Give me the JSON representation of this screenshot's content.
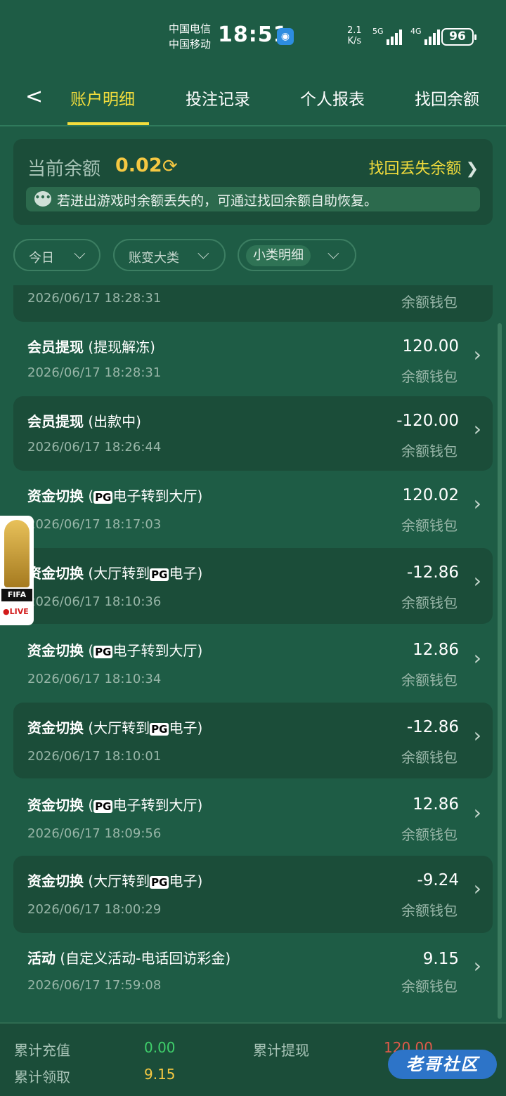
{
  "status_bar": {
    "carrier_1": "中国电信",
    "carrier_2": "中国移动",
    "time": "18:51",
    "net_speed_value": "2.1",
    "net_speed_unit": "K/s",
    "signal_1": "5G",
    "signal_2": "4G",
    "battery": "96"
  },
  "tabs": [
    "账户明细",
    "投注记录",
    "个人报表",
    "找回余额"
  ],
  "balance": {
    "label": "当前余额",
    "value": "0.02",
    "recover_label": "找回丢失余额",
    "notice": "若进出游戏时余额丢失的，可通过找回余额自助恢复。"
  },
  "filters": {
    "day": "今日",
    "category": "账变大类",
    "subcategory": "小类明细"
  },
  "transactions": [
    {
      "title": "",
      "detail": "",
      "time": "2026/06/17 18:28:31",
      "amount": "",
      "wallet": "余额钱包"
    },
    {
      "title": "会员提现",
      "detail": " (提现解冻)",
      "time": "2026/06/17 18:28:31",
      "amount": "120.00",
      "wallet": "余额钱包"
    },
    {
      "title": "会员提现",
      "detail": " (出款中)",
      "time": "2026/06/17 18:26:44",
      "amount": "-120.00",
      "wallet": "余额钱包"
    },
    {
      "title": "资金切换",
      "detail_pre": " (",
      "pg": "PG",
      "detail_post": "电子转到大厅)",
      "time": "2026/06/17 18:17:03",
      "amount": "120.02",
      "wallet": "余额钱包"
    },
    {
      "title": "资金切换",
      "detail_pre": " (大厅转到",
      "pg": "PG",
      "detail_post": "电子)",
      "time": "2026/06/17 18:10:36",
      "amount": "-12.86",
      "wallet": "余额钱包"
    },
    {
      "title": "资金切换",
      "detail_pre": " (",
      "pg": "PG",
      "detail_post": "电子转到大厅)",
      "time": "2026/06/17 18:10:34",
      "amount": "12.86",
      "wallet": "余额钱包"
    },
    {
      "title": "资金切换",
      "detail_pre": " (大厅转到",
      "pg": "PG",
      "detail_post": "电子)",
      "time": "2026/06/17 18:10:01",
      "amount": "-12.86",
      "wallet": "余额钱包"
    },
    {
      "title": "资金切换",
      "detail_pre": " (",
      "pg": "PG",
      "detail_post": "电子转到大厅)",
      "time": "2026/06/17 18:09:56",
      "amount": "12.86",
      "wallet": "余额钱包"
    },
    {
      "title": "资金切换",
      "detail_pre": " (大厅转到",
      "pg": "PG",
      "detail_post": "电子)",
      "time": "2026/06/17 18:00:29",
      "amount": "-9.24",
      "wallet": "余额钱包"
    },
    {
      "title": "活动",
      "detail": " (自定义活动-电话回访彩金)",
      "time": "2026/06/17 17:59:08",
      "amount": "9.15",
      "wallet": "余额钱包"
    }
  ],
  "floating_badge": {
    "label": "FIFA",
    "live": "●LIVE"
  },
  "footer": {
    "deposit_label": "累计充值",
    "deposit_value": "0.00",
    "withdraw_label": "累计提现",
    "withdraw_value": "120.00",
    "bonus_label": "累计领取",
    "bonus_value": "9.15"
  },
  "watermark": "老哥社区",
  "colors": {
    "background": "#1e5c45",
    "card": "#1b4d39",
    "accent_yellow": "#f3dd3c",
    "balance_yellow": "#f5c842",
    "deposit_green": "#3fcf6b",
    "withdraw_red": "#e05a4a",
    "bonus_yellow": "#f5c842"
  }
}
